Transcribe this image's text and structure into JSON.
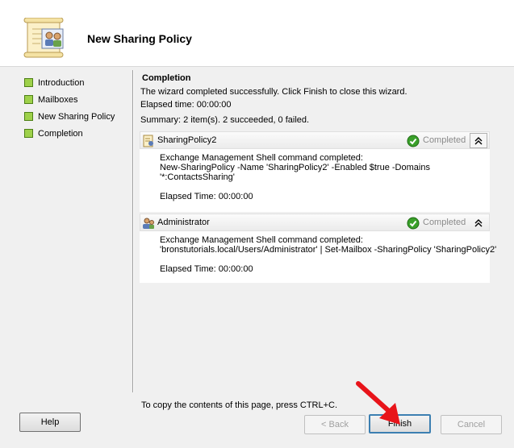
{
  "window": {
    "title": "New Sharing Policy"
  },
  "steps": [
    {
      "label": "Introduction"
    },
    {
      "label": "Mailboxes"
    },
    {
      "label": "New Sharing Policy"
    },
    {
      "label": "Completion"
    }
  ],
  "content": {
    "heading": "Completion",
    "message": "The wizard completed successfully. Click Finish to close this wizard.",
    "elapsed": "Elapsed time: 00:00:00",
    "summary": "Summary: 2 item(s). 2 succeeded, 0 failed."
  },
  "results": [
    {
      "name": "SharingPolicy2",
      "status": "Completed",
      "lines": [
        "Exchange Management Shell command completed:",
        "New-SharingPolicy -Name 'SharingPolicy2' -Enabled $true -Domains",
        "'*:ContactsSharing'",
        "",
        "Elapsed Time: 00:00:00"
      ]
    },
    {
      "name": "Administrator",
      "status": "Completed",
      "lines": [
        "Exchange Management Shell command completed:",
        "'bronstutorials.local/Users/Administrator' | Set-Mailbox -SharingPolicy 'SharingPolicy2'",
        "",
        "Elapsed Time: 00:00:00"
      ]
    }
  ],
  "footer": {
    "hint": "To copy the contents of this page, press CTRL+C.",
    "help": "Help",
    "back": "< Back",
    "finish": "Finish",
    "cancel": "Cancel"
  },
  "colors": {
    "accent": "#3c7fb1",
    "step_bullet": "#9ed14a",
    "success": "#3aa02a",
    "arrow": "#e8141a"
  }
}
